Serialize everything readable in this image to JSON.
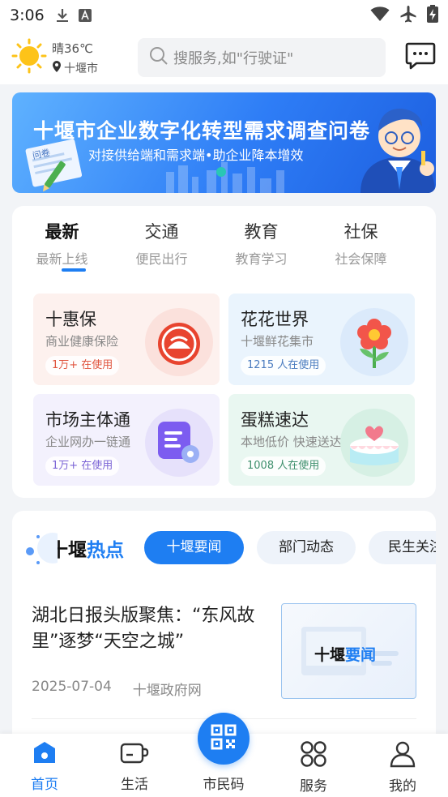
{
  "status_bar": {
    "time": "3:06"
  },
  "header": {
    "weather": {
      "condition": "晴36℃",
      "city": "十堰市"
    },
    "search": {
      "placeholder": "搜服务,如\"行驶证\""
    }
  },
  "banner": {
    "title": "十堰市企业数字化转型需求调查问卷",
    "subtitle": "对接供给端和需求端•助企业降本增效",
    "paper_label": "问卷"
  },
  "service_tabs": [
    {
      "title": "最新",
      "subtitle": "最新上线",
      "active": true
    },
    {
      "title": "交通",
      "subtitle": "便民出行",
      "active": false
    },
    {
      "title": "教育",
      "subtitle": "教育学习",
      "active": false
    },
    {
      "title": "社保",
      "subtitle": "社会保障",
      "active": false
    }
  ],
  "service_tiles": [
    {
      "name": "十惠保",
      "desc": "商业健康保险",
      "users": "1万+ 在使用",
      "icon": "insurance-icon",
      "bg": "#fdf1ee",
      "user_color": "#e0533d"
    },
    {
      "name": "花花世界",
      "desc": "十堰鲜花集市",
      "users": "1215 人在使用",
      "icon": "flower-icon",
      "bg": "#eaf4fd",
      "user_color": "#4a7bbf"
    },
    {
      "name": "市场主体通",
      "desc": "企业网办一链通",
      "users": "1万+ 在使用",
      "icon": "document-settings-icon",
      "bg": "#f3f1fd",
      "user_color": "#7b64d6"
    },
    {
      "name": "蛋糕速达",
      "desc": "本地低价 快速送达",
      "users": "1008 人在使用",
      "icon": "cake-icon",
      "bg": "#e9f7f1",
      "user_color": "#3e8f6c"
    }
  ],
  "hot_news": {
    "logo_part1": "十堰",
    "logo_part2": "热点",
    "filters": [
      {
        "label": "十堰要闻",
        "active": true
      },
      {
        "label": "部门动态",
        "active": false
      },
      {
        "label": "民生关注",
        "active": false
      }
    ],
    "article": {
      "title": "湖北日报头版聚焦：“东风故里”逐梦“天空之城”",
      "date": "2025-07-04",
      "source": "十堰政府网",
      "thumb_part1": "十堰",
      "thumb_part2": "要闻"
    }
  },
  "bottom_nav": [
    {
      "label": "首页",
      "active": true
    },
    {
      "label": "生活",
      "active": false
    },
    {
      "label": "市民码",
      "active": false
    },
    {
      "label": "服务",
      "active": false
    },
    {
      "label": "我的",
      "active": false
    }
  ],
  "colors": {
    "accent": "#1e7ef2",
    "page_bg": "#f2f4f7"
  }
}
